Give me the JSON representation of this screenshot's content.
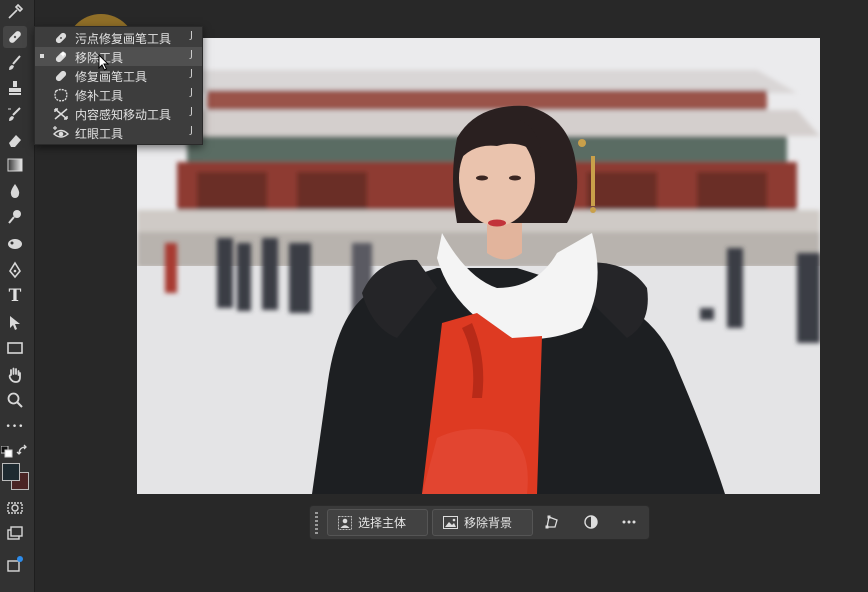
{
  "tool_menu": {
    "items": [
      {
        "label": "污点修复画笔工具",
        "shortcut": "J",
        "icon": "spot-healing-brush-icon"
      },
      {
        "label": "移除工具",
        "shortcut": "J",
        "icon": "remove-tool-icon",
        "selected": true
      },
      {
        "label": "修复画笔工具",
        "shortcut": "J",
        "icon": "healing-brush-icon"
      },
      {
        "label": "修补工具",
        "shortcut": "J",
        "icon": "patch-tool-icon"
      },
      {
        "label": "内容感知移动工具",
        "shortcut": "J",
        "icon": "content-aware-move-icon"
      },
      {
        "label": "红眼工具",
        "shortcut": "J",
        "icon": "red-eye-icon"
      }
    ]
  },
  "taskbar": {
    "select_subject": "选择主体",
    "remove_background": "移除背景"
  },
  "toolbar": {
    "text_tool_glyph": "T",
    "more_glyph": "•••"
  },
  "colors": {
    "foreground": "#1e2a30",
    "background": "#4a2424",
    "highlight": "#e6aa28"
  }
}
